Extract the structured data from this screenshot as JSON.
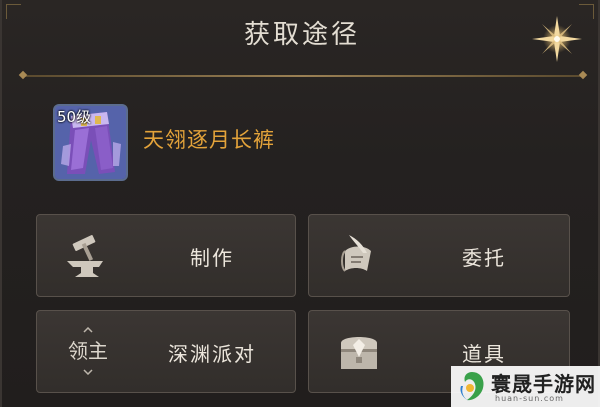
{
  "dialog": {
    "title": "获取途径"
  },
  "item": {
    "level_badge": "50级",
    "name": "天翎逐月长裤",
    "icon": "purple-pants-icon"
  },
  "sources": [
    {
      "label": "制作",
      "icon": "anvil-hammer-icon"
    },
    {
      "label": "委托",
      "icon": "scroll-quill-icon"
    },
    {
      "label": "深渊派对",
      "icon": "lord-icon",
      "icon_text": "领主"
    },
    {
      "label": "道具",
      "icon": "treasure-chest-icon"
    }
  ],
  "watermark": {
    "brand": "寰晟手游网",
    "url": "huan-sun.com"
  },
  "colors": {
    "accent_gold": "#e3a33a",
    "text_light": "#ece6dc",
    "panel_bg": "#242120"
  }
}
